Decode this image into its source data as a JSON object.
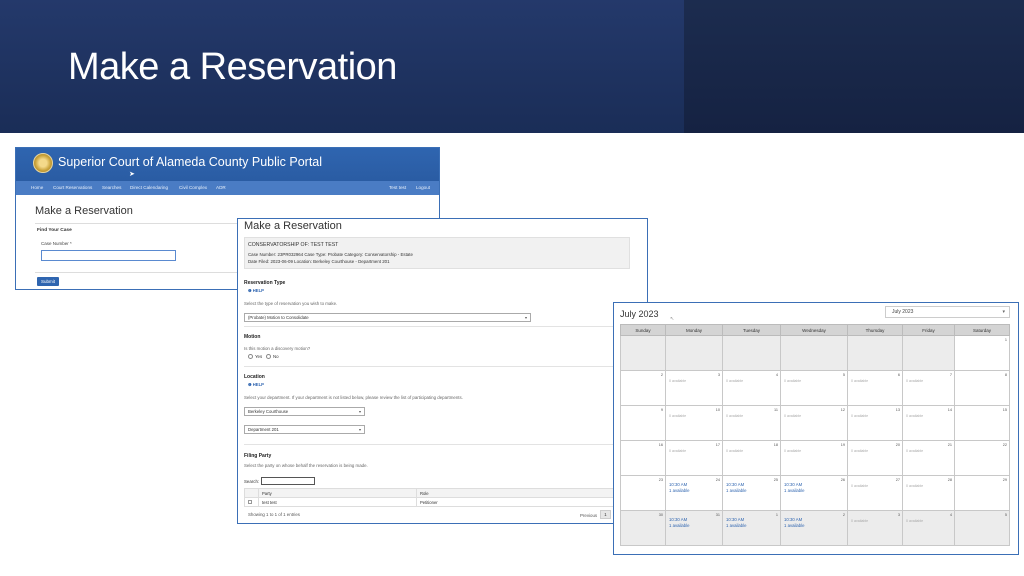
{
  "slide": {
    "title": "Make a Reservation"
  },
  "portal": {
    "title": "Superior Court of Alameda County Public Portal",
    "nav": [
      "Home",
      "Court Reservations",
      "Searches",
      "Direct Calendaring",
      "Civil Complex",
      "ADR"
    ],
    "nav_right": [
      "Test test",
      "Logout"
    ],
    "heading": "Make a Reservation",
    "find_case": "Find Your Case",
    "case_label": "Case Number *",
    "submit": "Submit"
  },
  "form": {
    "heading": "Make a Reservation",
    "case_title": "CONSERVATORSHIP OF: TEST TEST",
    "case_line1": "Case Number: 23PR032964     Case Type: Probate     Category: Conservatorship - Estate",
    "case_line2": "Date Filed: 2023-06-09   Location: Berkeley Courthouse - Department 201",
    "reservation_type_label": "Reservation Type",
    "help": "HELP",
    "reservation_type_hint": "Select the type of reservation you wish to make.",
    "reservation_type_value": "(Probate) Motion to Consolidate",
    "motion_label": "Motion",
    "motion_question": "Is this motion a discovery motion?",
    "yes": "Yes",
    "no": "No",
    "location_label": "Location",
    "location_hint": "Select your department. If your department is not listed below, please review the list of participating departments.",
    "courthouse_value": "Berkeley Courthouse",
    "department_value": "Department 201",
    "filing_party_label": "Filing Party",
    "filing_party_hint": "Select the party on whose behalf the reservation is being made.",
    "search_label": "Search:",
    "table_headers": [
      "Party",
      "Role"
    ],
    "table_rows": [
      [
        "test test",
        "Petitioner"
      ]
    ],
    "showing": "Showing 1 to 1 of 1 entries",
    "previous": "Previous",
    "page": "1"
  },
  "calendar": {
    "title": "July 2023",
    "month_select": "July 2023",
    "weekdays": [
      "Sunday",
      "Monday",
      "Tuesday",
      "Wednesday",
      "Thursday",
      "Friday",
      "Saturday"
    ],
    "available_text": "0 available",
    "slot_time": "10:30 AM",
    "slot_available": "1 available",
    "weeks": [
      [
        "",
        "",
        "",
        "",
        "",
        "",
        "1"
      ],
      [
        "2",
        "3",
        "4",
        "5",
        "6",
        "7",
        "8"
      ],
      [
        "9",
        "10",
        "11",
        "12",
        "13",
        "14",
        "15"
      ],
      [
        "16",
        "17",
        "18",
        "19",
        "20",
        "21",
        "22"
      ],
      [
        "23",
        "24",
        "25",
        "26",
        "27",
        "28",
        "29"
      ],
      [
        "30",
        "31",
        "1",
        "2",
        "3",
        "4",
        "5"
      ]
    ]
  }
}
